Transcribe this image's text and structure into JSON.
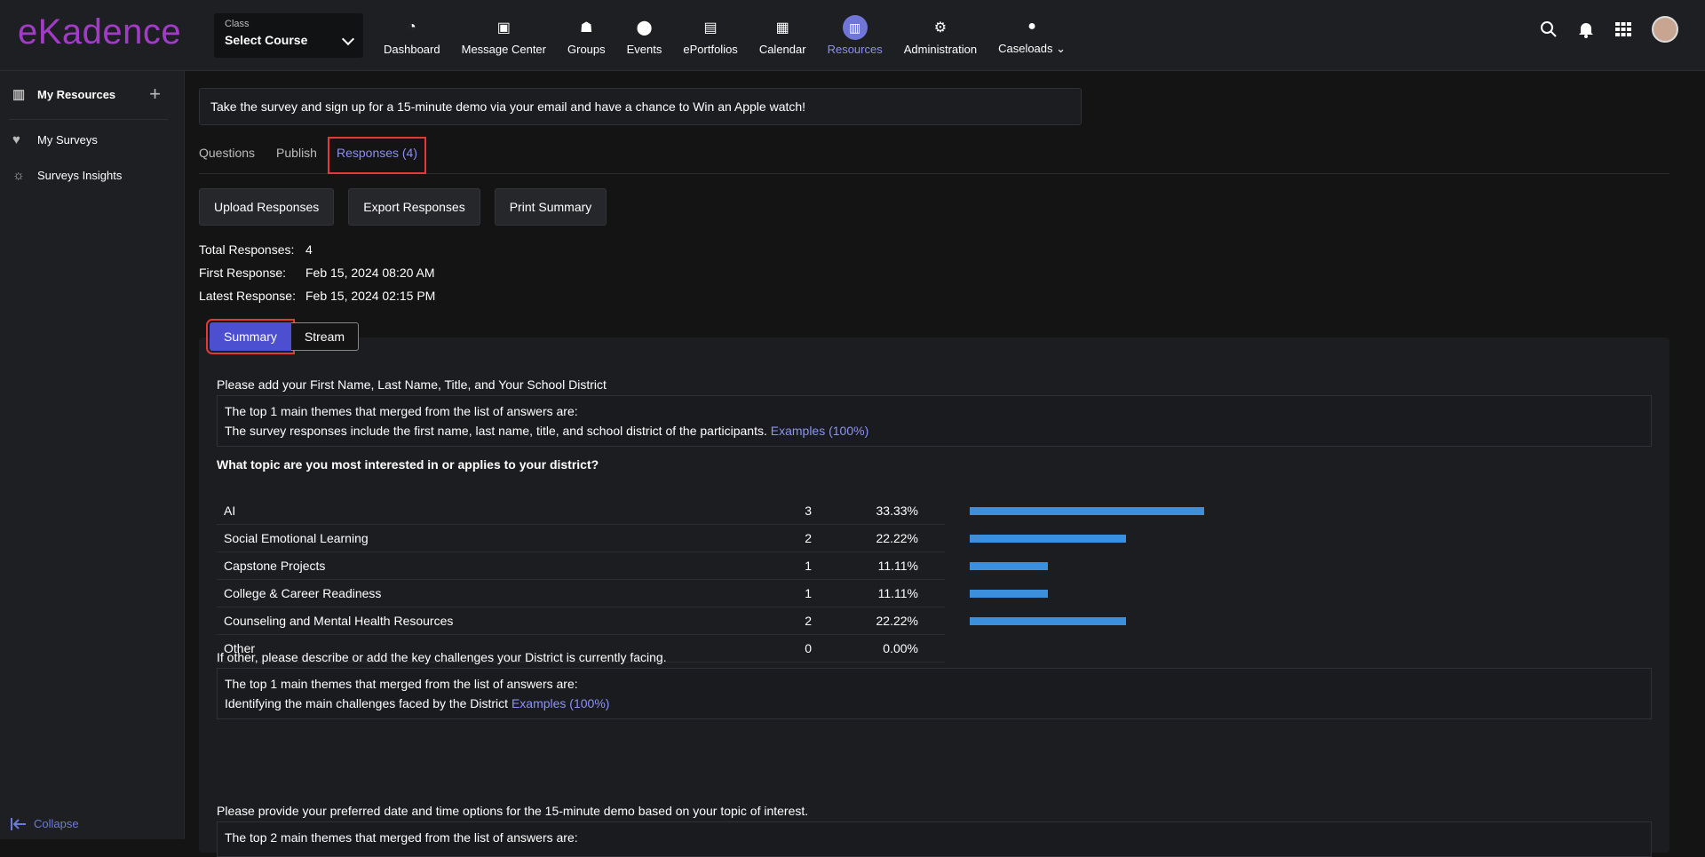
{
  "brand": {
    "logo_text": "eKadence"
  },
  "class_selector": {
    "label": "Class",
    "value": "Select Course"
  },
  "nav": [
    {
      "label": "Dashboard",
      "icon": "gauge-icon",
      "glyph": "◔"
    },
    {
      "label": "Message Center",
      "icon": "chat-icon",
      "glyph": "▣"
    },
    {
      "label": "Groups",
      "icon": "group-icon",
      "glyph": "☗"
    },
    {
      "label": "Events",
      "icon": "pin-icon",
      "glyph": "⬤"
    },
    {
      "label": "ePortfolios",
      "icon": "briefcase-icon",
      "glyph": "▤"
    },
    {
      "label": "Calendar",
      "icon": "calendar-icon",
      "glyph": "▦"
    },
    {
      "label": "Resources",
      "icon": "library-icon",
      "glyph": "▥"
    },
    {
      "label": "Administration",
      "icon": "gears-icon",
      "glyph": "⚙"
    },
    {
      "label": "Caseloads ⌄",
      "icon": "user-icon",
      "glyph": "●"
    }
  ],
  "sidebar": {
    "items": [
      {
        "label": "My Resources",
        "icon": "library-icon",
        "glyph": "▥"
      },
      {
        "label": "My Surveys",
        "icon": "heart-pulse-icon",
        "glyph": "♥"
      },
      {
        "label": "Surveys Insights",
        "icon": "lightbulb-icon",
        "glyph": "☼"
      }
    ],
    "add_glyph": "+",
    "collapse_label": "Collapse"
  },
  "banner": "Take the survey and sign up for a 15-minute demo via your email and have a chance to Win an Apple watch!",
  "tabs": [
    "Questions",
    "Publish",
    "Responses (4)"
  ],
  "buttons": [
    "Upload Responses",
    "Export Responses",
    "Print Summary"
  ],
  "stats": [
    {
      "k": "Total Responses:",
      "v": "4"
    },
    {
      "k": "First Response:",
      "v": "Feb 15, 2024 08:20 AM"
    },
    {
      "k": "Latest Response:",
      "v": "Feb 15, 2024 02:15 PM"
    }
  ],
  "view_toggle": {
    "summary": "Summary",
    "stream": "Stream"
  },
  "q1": {
    "title": "Please add your First Name, Last Name, Title, and Your School District",
    "line1": "The top 1 main themes that merged from the list of answers are:",
    "line2": "The survey responses include the first name, last name, title, and school district of the participants.",
    "link": "Examples (100%)"
  },
  "q2": {
    "title": "What topic are you most interested in or applies to your district?"
  },
  "chart_data": {
    "type": "bar",
    "categories": [
      "AI",
      "Social Emotional Learning",
      "Capstone Projects",
      "College & Career Readiness",
      "Counseling and Mental Health Resources",
      "Other"
    ],
    "counts": [
      "3",
      "2",
      "1",
      "1",
      "2",
      "0"
    ],
    "percents": [
      "33.33%",
      "22.22%",
      "11.11%",
      "11.11%",
      "22.22%",
      "0.00%"
    ],
    "values": [
      33.33,
      22.22,
      11.11,
      11.11,
      22.22,
      0
    ],
    "bar_color": "#3b8fdc"
  },
  "q3": {
    "title": "If other, please describe or add the key challenges your District is currently facing.",
    "line1": "The top 1 main themes that merged from the list of answers are:",
    "line2": "Identifying the main challenges faced by the District",
    "link": "Examples (100%)"
  },
  "q4": {
    "title": "Please provide your preferred date and time options for the 15-minute demo based on your topic of interest.",
    "line1": "The top 2 main themes that merged from the list of answers are:"
  }
}
